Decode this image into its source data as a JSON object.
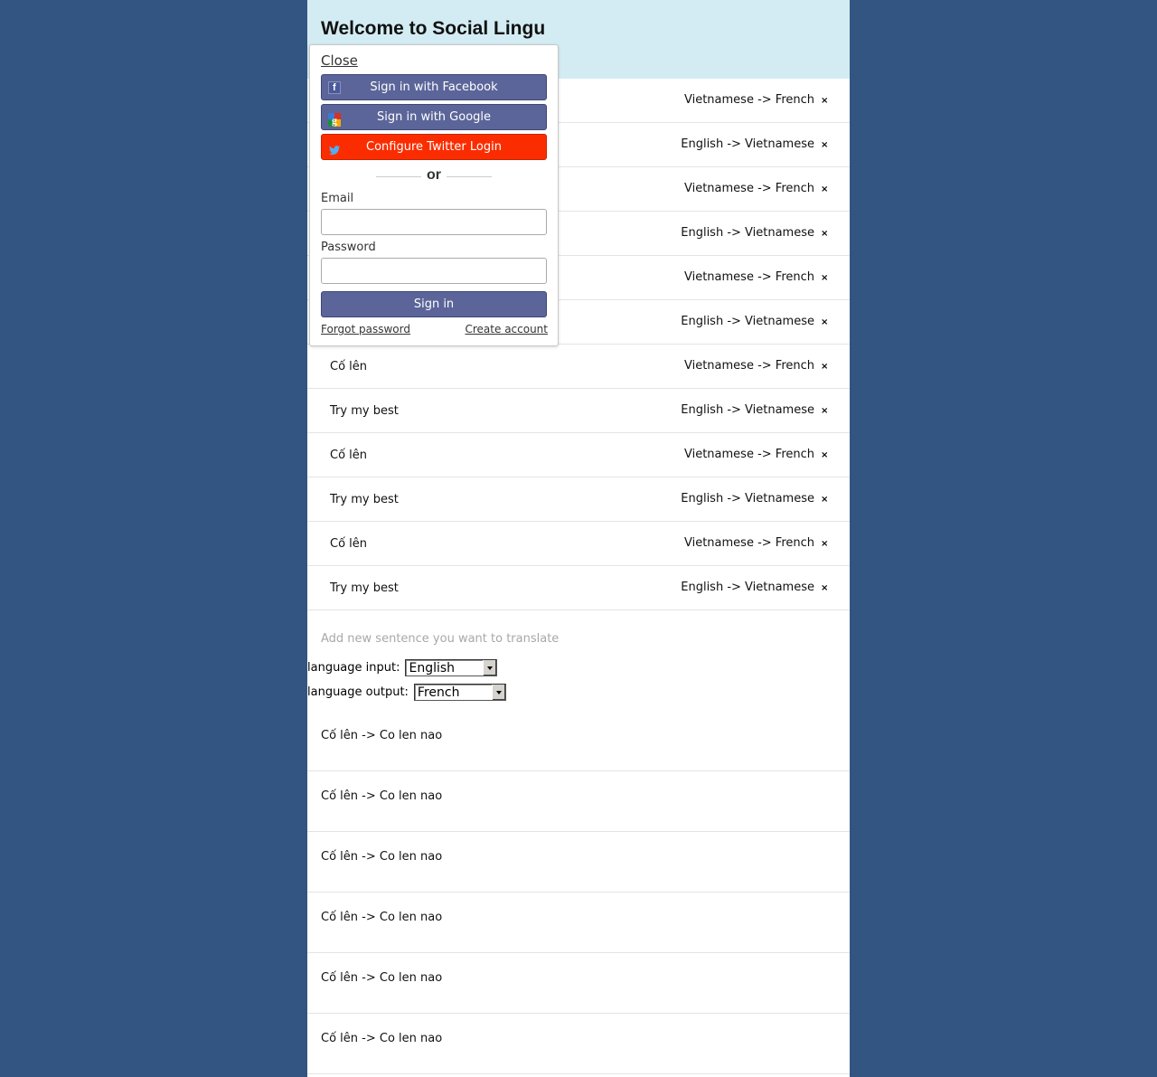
{
  "header": {
    "title": "Welcome to Social Lingu"
  },
  "sentences": [
    {
      "text": "",
      "lang": "Vietnamese -> French"
    },
    {
      "text": "",
      "lang": "English -> Vietnamese"
    },
    {
      "text": "",
      "lang": "Vietnamese -> French"
    },
    {
      "text": "",
      "lang": "English -> Vietnamese"
    },
    {
      "text": "",
      "lang": "Vietnamese -> French"
    },
    {
      "text": "",
      "lang": "English -> Vietnamese"
    },
    {
      "text": "Cố lên",
      "lang": "Vietnamese -> French"
    },
    {
      "text": "Try my best",
      "lang": "English -> Vietnamese"
    },
    {
      "text": "Cố lên",
      "lang": "Vietnamese -> French"
    },
    {
      "text": "Try my best",
      "lang": "English -> Vietnamese"
    },
    {
      "text": "Cố lên",
      "lang": "Vietnamese -> French"
    },
    {
      "text": "Try my best",
      "lang": "English -> Vietnamese"
    }
  ],
  "remove_icon": "×",
  "add_sentence": {
    "placeholder": "Add new sentence you want to translate",
    "value": ""
  },
  "language_input": {
    "label": "language input:",
    "selected": "English"
  },
  "language_output": {
    "label": "language output:",
    "selected": "French"
  },
  "translations": [
    "Cố lên -> Co len nao",
    "Cố lên -> Co len nao",
    "Cố lên -> Co len nao",
    "Cố lên -> Co len nao",
    "Cố lên -> Co len nao",
    "Cố lên -> Co len nao"
  ],
  "login_popup": {
    "close_label": "Close",
    "facebook_label": "Sign in with Facebook",
    "google_label": "Sign in with Google",
    "twitter_label": "Configure Twitter Login",
    "divider_text": "or",
    "email_label": "Email",
    "email_value": "",
    "password_label": "Password",
    "password_value": "",
    "signin_label": "Sign in",
    "forgot_label": "Forgot password",
    "create_label": "Create account"
  },
  "colors": {
    "page_background": "#325581",
    "header_background": "#d3ecf3",
    "button_primary": "#5b6599",
    "button_twitter": "#fb2d00"
  },
  "icons": {
    "facebook": "facebook-icon",
    "google": "google-icon",
    "twitter": "twitter-icon",
    "remove": "remove-icon"
  }
}
